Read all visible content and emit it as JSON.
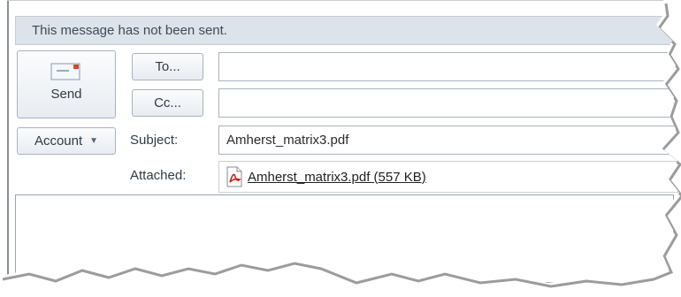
{
  "infobar": {
    "message": "This message has not been sent."
  },
  "buttons": {
    "send_label": "Send",
    "to_label": "To...",
    "cc_label": "Cc...",
    "account_label": "Account"
  },
  "fields": {
    "to_value": "",
    "cc_value": "",
    "subject_label": "Subject:",
    "subject_value": "Amherst_matrix3.pdf",
    "attached_label": "Attached:"
  },
  "attachment": {
    "name": "Amherst_matrix3.pdf (557 KB)",
    "icon": "pdf-file-icon"
  },
  "colors": {
    "infobar_bg": "#dde3ea",
    "pdf_red": "#c8251d"
  }
}
